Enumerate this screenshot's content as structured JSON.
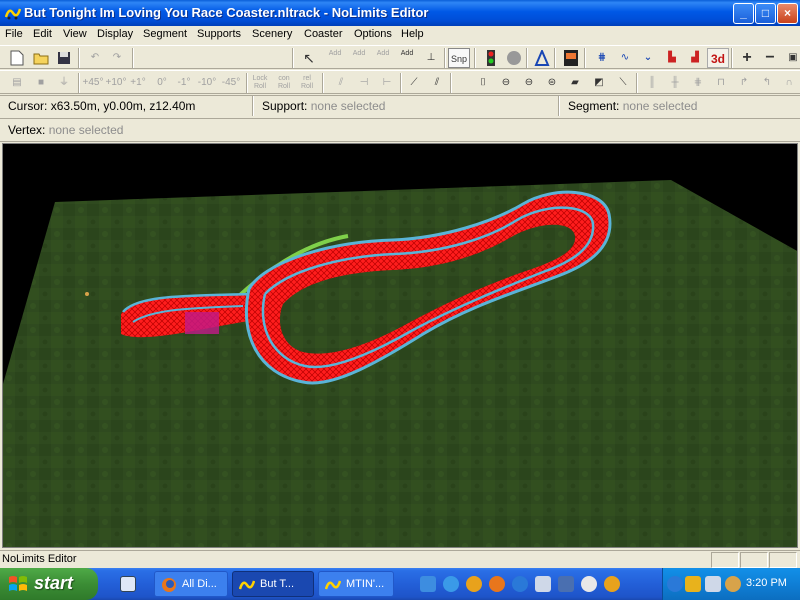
{
  "window": {
    "title": "But Tonight Im Loving You Race Coaster.nltrack - NoLimits Editor",
    "controls": {
      "minimize": "_",
      "maximize": "□",
      "close": "×"
    }
  },
  "menu": [
    "File",
    "Edit",
    "View",
    "Display",
    "Segment",
    "Supports",
    "Scenery",
    "Coaster",
    "Options",
    "Help"
  ],
  "toolbar1": {
    "snap": "Snp",
    "add_labels": [
      "Add",
      "Add",
      "Add",
      "Add"
    ],
    "view3d": "3d"
  },
  "toolbar2": {
    "angles": [
      "+45°",
      "+10°",
      "+1°",
      "0°",
      "-1°",
      "-10°",
      "-45°"
    ],
    "lock_roll": [
      "Lock",
      "Roll"
    ],
    "con_roll": [
      "con",
      "Roll"
    ],
    "rel_roll": [
      "rel",
      "Roll"
    ]
  },
  "info": {
    "cursor_label": "Cursor:",
    "cursor_value": "x63.50m, y0.00m, z12.40m",
    "support_label": "Support:",
    "support_value": "none selected",
    "segment_label": "Segment:",
    "segment_value": "none selected",
    "vertex_label": "Vertex:",
    "vertex_value": "none selected"
  },
  "status": {
    "text": "NoLimits Editor"
  },
  "taskbar": {
    "start": "start",
    "tasks": [
      "All Di...",
      "But T...",
      "MTIN'..."
    ],
    "clock": "3:20 PM"
  },
  "colors": {
    "ground": "#2f4a1f",
    "track_structure": "#ff1a1a",
    "rail": "#5ab4d8",
    "lift": "#7fd04a",
    "titlebar": "#0058e6"
  }
}
